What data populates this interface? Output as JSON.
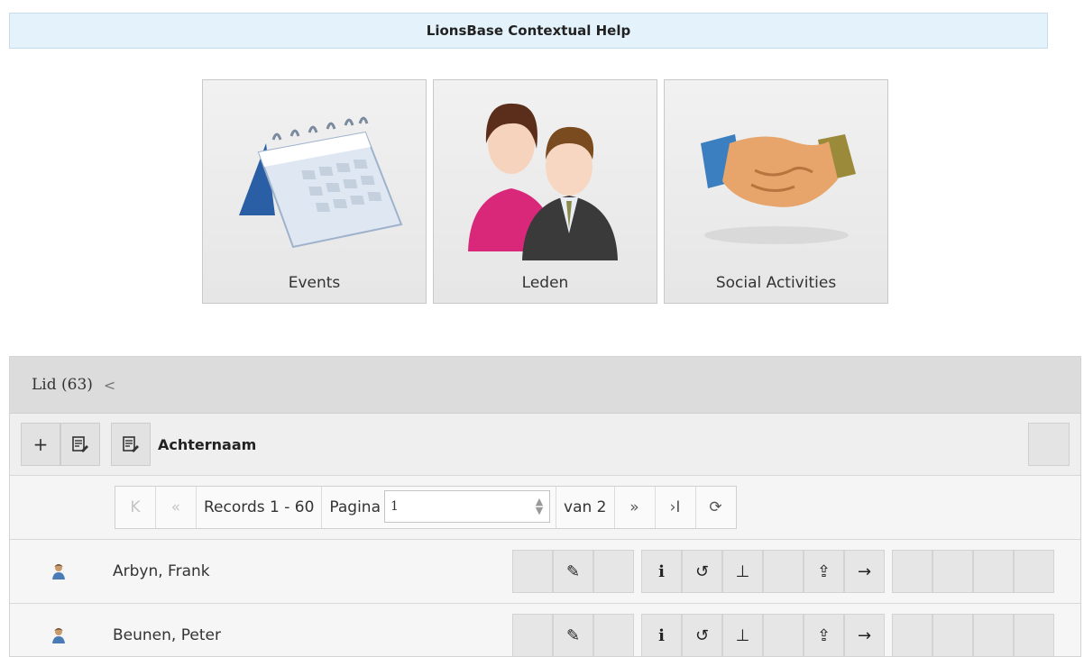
{
  "help_bar": {
    "title": "LionsBase Contextual Help"
  },
  "tiles": [
    {
      "label": "Events",
      "icon": "calendar-icon"
    },
    {
      "label": "Leden",
      "icon": "people-icon"
    },
    {
      "label": "Social Activities",
      "icon": "handshake-icon"
    }
  ],
  "panel": {
    "title": "Lid (63)",
    "chevron": "<",
    "toolbar": {
      "add": "+",
      "sort_label": "Achternaam"
    },
    "pager": {
      "first": "K",
      "prev": "«",
      "records": "Records 1 - 60",
      "page_label": "Pagina",
      "page_value": "1",
      "of_label": "van 2",
      "next": "»",
      "last": "›I",
      "refresh": "⟳"
    },
    "rows": [
      {
        "name": "Arbyn, Frank"
      },
      {
        "name": "Beunen, Peter"
      }
    ],
    "row_action_glyphs": {
      "edit": "✎",
      "info": "i",
      "history": "↺",
      "user": "⊥",
      "export": "⇪",
      "go": "→"
    }
  }
}
